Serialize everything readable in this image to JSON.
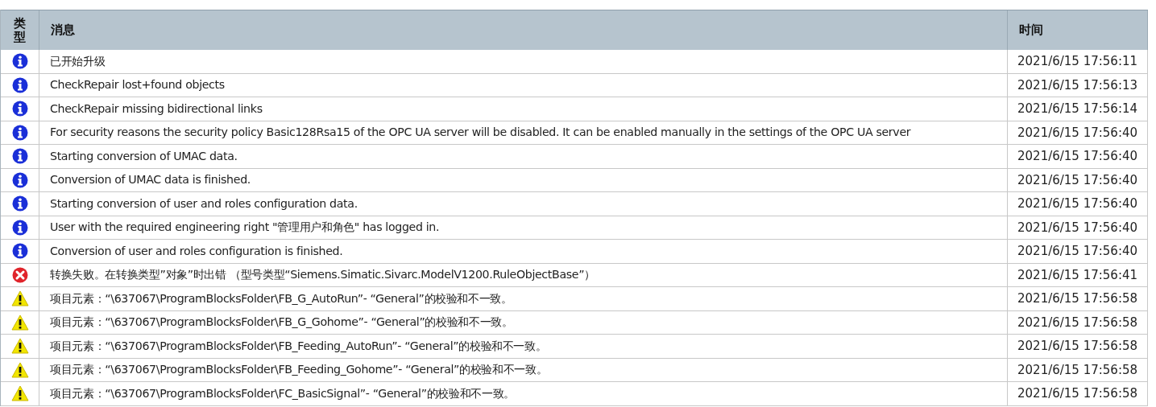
{
  "table": {
    "columns": [
      {
        "label": "类型"
      },
      {
        "label": "消息"
      },
      {
        "label": "时间"
      }
    ],
    "rows": [
      {
        "kind": "info",
        "message": "已开始升级",
        "time": "2021/6/15 17:56:11"
      },
      {
        "kind": "info",
        "message": "CheckRepair lost+found objects",
        "time": "2021/6/15 17:56:13"
      },
      {
        "kind": "info",
        "message": "CheckRepair missing bidirectional links",
        "time": "2021/6/15 17:56:14"
      },
      {
        "kind": "info",
        "message": "For security reasons the security policy Basic128Rsa15 of the OPC UA server will be disabled. It can be enabled manually in the settings of the OPC UA server",
        "time": "2021/6/15 17:56:40"
      },
      {
        "kind": "info",
        "message": "Starting conversion of UMAC data.",
        "time": "2021/6/15 17:56:40"
      },
      {
        "kind": "info",
        "message": "Conversion of UMAC data is finished.",
        "time": "2021/6/15 17:56:40"
      },
      {
        "kind": "info",
        "message": "Starting conversion of user and roles configuration data.",
        "time": "2021/6/15 17:56:40"
      },
      {
        "kind": "info",
        "message": "User with the required engineering right \"管理用户和角色\" has logged in.",
        "time": "2021/6/15 17:56:40"
      },
      {
        "kind": "info",
        "message": "Conversion of user and roles configuration is finished.",
        "time": "2021/6/15 17:56:40"
      },
      {
        "kind": "error",
        "message": "转换失败。在转换类型”对象”时出错 （型号类型“Siemens.Simatic.Sivarc.ModelV1200.RuleObjectBase”）",
        "time": "2021/6/15 17:56:41"
      },
      {
        "kind": "warning",
        "message": "项目元素：“\\637067\\ProgramBlocksFolder\\FB_G_AutoRun”- “General”的校验和不一致。",
        "time": "2021/6/15 17:56:58"
      },
      {
        "kind": "warning",
        "message": "项目元素：“\\637067\\ProgramBlocksFolder\\FB_G_Gohome”- “General”的校验和不一致。",
        "time": "2021/6/15 17:56:58"
      },
      {
        "kind": "warning",
        "message": "项目元素：“\\637067\\ProgramBlocksFolder\\FB_Feeding_AutoRun”- “General”的校验和不一致。",
        "time": "2021/6/15 17:56:58"
      },
      {
        "kind": "warning",
        "message": "项目元素：“\\637067\\ProgramBlocksFolder\\FB_Feeding_Gohome”- “General”的校验和不一致。",
        "time": "2021/6/15 17:56:58"
      },
      {
        "kind": "warning",
        "message": "项目元素：“\\637067\\ProgramBlocksFolder\\FC_BasicSignal”- “General”的校验和不一致。",
        "time": "2021/6/15 17:56:58"
      }
    ]
  }
}
